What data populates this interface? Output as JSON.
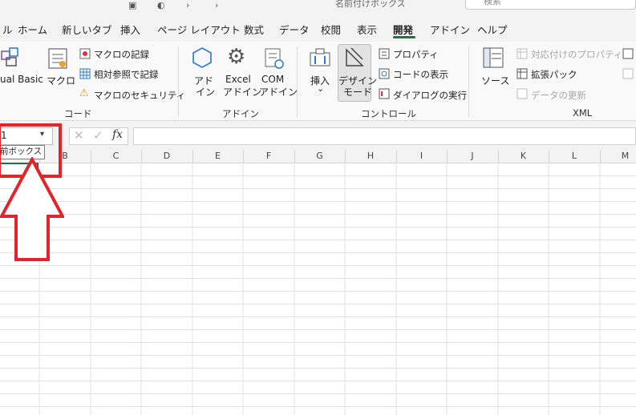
{
  "titlebar": {
    "doc_title": "名前付けボックス",
    "search_placeholder": "検索"
  },
  "tabs": [
    {
      "label": "ル"
    },
    {
      "label": "ホーム"
    },
    {
      "label": "新しいタブ"
    },
    {
      "label": "挿入"
    },
    {
      "label": "ページ レイアウト"
    },
    {
      "label": "数式"
    },
    {
      "label": "データ"
    },
    {
      "label": "校閲"
    },
    {
      "label": "表示"
    },
    {
      "label": "開発",
      "active": true
    },
    {
      "label": "アドイン"
    },
    {
      "label": "ヘルプ"
    }
  ],
  "ribbon": {
    "code": {
      "visual_basic": "ual Basic",
      "macro": "マクロ",
      "record_macro": "マクロの記録",
      "relative_ref": "相対参照で記録",
      "macro_security": "マクロのセキュリティ",
      "group": "コード"
    },
    "addins": {
      "addin_1": "アド",
      "addin_2": "イン",
      "excel_1": "Excel",
      "excel_2": "アドイン",
      "com_1": "COM",
      "com_2": "アドイン",
      "group": "アドイン"
    },
    "controls": {
      "insert": "挿入",
      "insert_arrow": "⌄",
      "design_1": "デザイン",
      "design_2": "モード",
      "properties": "プロパティ",
      "view_code": "コードの表示",
      "run_dialog": "ダイアログの実行",
      "group": "コントロール"
    },
    "xml": {
      "source": "ソース",
      "map_properties": "対応付けのプロパティ",
      "expansion_packs": "拡張パック",
      "refresh_data": "データの更新",
      "group": "XML"
    }
  },
  "formula_bar": {
    "namebox_value": "1",
    "fx_label": "fx"
  },
  "tooltip": "前ボックス",
  "columns": [
    "B",
    "C",
    "D",
    "E",
    "F",
    "G",
    "H",
    "I",
    "J",
    "K",
    "L",
    "M"
  ],
  "colors": {
    "accent_green": "#1e7145",
    "highlight_red": "#e3242b"
  }
}
